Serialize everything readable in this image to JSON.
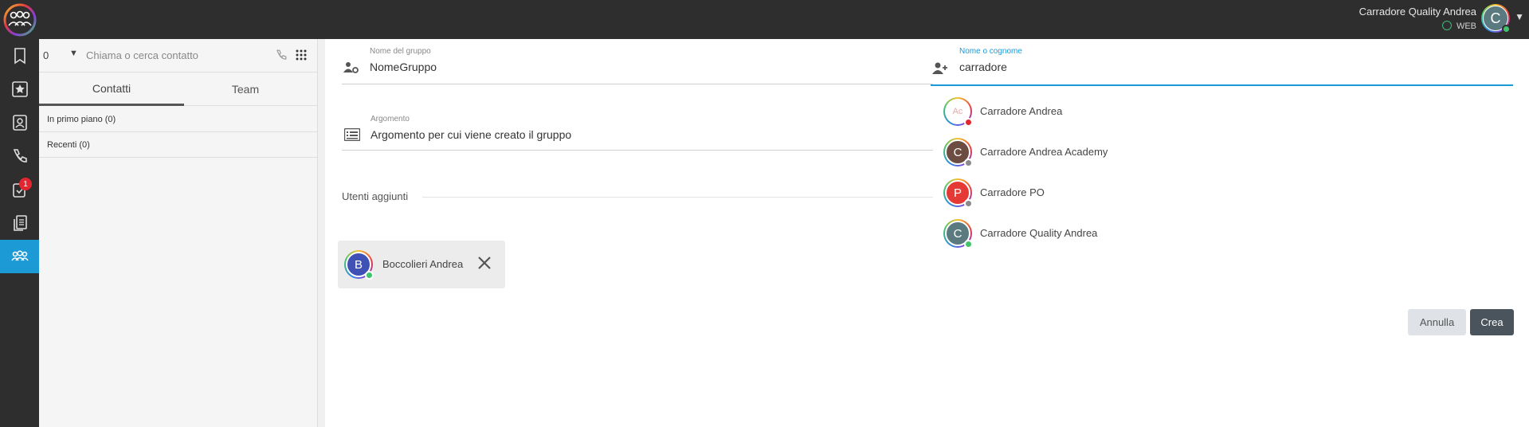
{
  "app": {
    "user_name": "Carradore Quality Andrea",
    "user_status": "WEB",
    "user_initial": "C"
  },
  "sidebar": {
    "items": [
      {
        "name": "bookmark-icon"
      },
      {
        "name": "star-icon"
      },
      {
        "name": "contacts-book-icon"
      },
      {
        "name": "phone-icon"
      },
      {
        "name": "tasks-icon",
        "badge": "1"
      },
      {
        "name": "documents-icon"
      },
      {
        "name": "groups-icon",
        "active": true
      }
    ]
  },
  "contacts_panel": {
    "line_number": "0",
    "search_placeholder": "Chiama o cerca contatto",
    "tabs": [
      {
        "label": "Contatti",
        "active": true
      },
      {
        "label": "Team",
        "active": false
      }
    ],
    "groups": [
      {
        "label": "In primo piano (0)"
      },
      {
        "label": "Recenti (0)"
      }
    ]
  },
  "form": {
    "group_name_label": "Nome del gruppo",
    "group_name_value": "NomeGruppo",
    "topic_label": "Argomento",
    "topic_value": "Argomento per cui viene creato il gruppo",
    "added_users_label": "Utenti aggiunti",
    "added_users": [
      {
        "name": "Boccolieri Andrea",
        "initial": "B",
        "color": "#3f51b5",
        "status": "#3fc46c"
      }
    ],
    "search_label": "Nome o cognome",
    "search_value": "carradore",
    "results": [
      {
        "name": "Carradore Andrea",
        "initial": "Ac",
        "color": "#ffffff",
        "text_color": "#e9a8a8",
        "status": "#e3262f"
      },
      {
        "name": "Carradore Andrea Academy",
        "initial": "C",
        "color": "#6d4c41",
        "text_color": "#ffffff",
        "status": "#8a8a8a"
      },
      {
        "name": "Carradore PO",
        "initial": "P",
        "color": "#e53935",
        "text_color": "#ffffff",
        "status": "#8a8a8a"
      },
      {
        "name": "Carradore Quality Andrea",
        "initial": "C",
        "color": "#5a7a80",
        "text_color": "#ffffff",
        "status": "#3fc46c"
      }
    ],
    "cancel_label": "Annulla",
    "create_label": "Crea"
  },
  "colors": {
    "accent": "#1b9ad6",
    "dark": "#2e2e2e",
    "create_button": "#4a545c"
  }
}
